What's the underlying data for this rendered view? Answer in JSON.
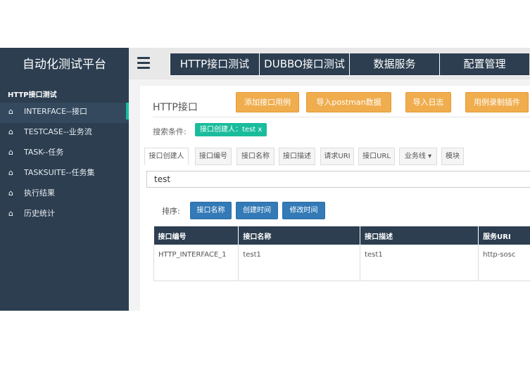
{
  "sidebar": {
    "brand": "自动化测试平台",
    "section": "HTTP接口测试",
    "items": [
      {
        "label": "INTERFACE--接口",
        "icon": "home-icon"
      },
      {
        "label": "TESTCASE--业务流",
        "icon": "home-icon"
      },
      {
        "label": "TASK--任务",
        "icon": "home-icon"
      },
      {
        "label": "TASKSUITE--任务集",
        "icon": "home-icon"
      },
      {
        "label": "执行结果",
        "icon": "home-icon"
      },
      {
        "label": "历史统计",
        "icon": "home-icon"
      }
    ]
  },
  "topnav": {
    "tabs": [
      "HTTP接口测试",
      "DUBBO接口测试",
      "数据服务",
      "配置管理"
    ]
  },
  "panel": {
    "title": "HTTP接口",
    "buttons": [
      "添加接口用例",
      "导入postman数据",
      "导入日志",
      "用例录制插件"
    ]
  },
  "filter": {
    "label": "搜索条件:",
    "chip": "接口创建人：test  x"
  },
  "filter_tabs": [
    "接口创建人",
    "接口编号",
    "接口名称",
    "接口描述",
    "请求URI",
    "接口URL",
    "业务线 ▾",
    "模块"
  ],
  "search": {
    "value": "test"
  },
  "sort": {
    "label": "排序:",
    "buttons": [
      "接口名称",
      "创建时间",
      "修改时间"
    ]
  },
  "table": {
    "columns": [
      "接口编号",
      "接口名称",
      "接口描述",
      "服务URI"
    ],
    "rows": [
      [
        "HTTP_INTERFACE_1",
        "test1",
        "test1",
        "http-sosc"
      ]
    ]
  },
  "colors": {
    "nav": "#2c3e50",
    "accent": "#1abc9c",
    "orange": "#f0ad4e",
    "blue": "#337ab7"
  }
}
